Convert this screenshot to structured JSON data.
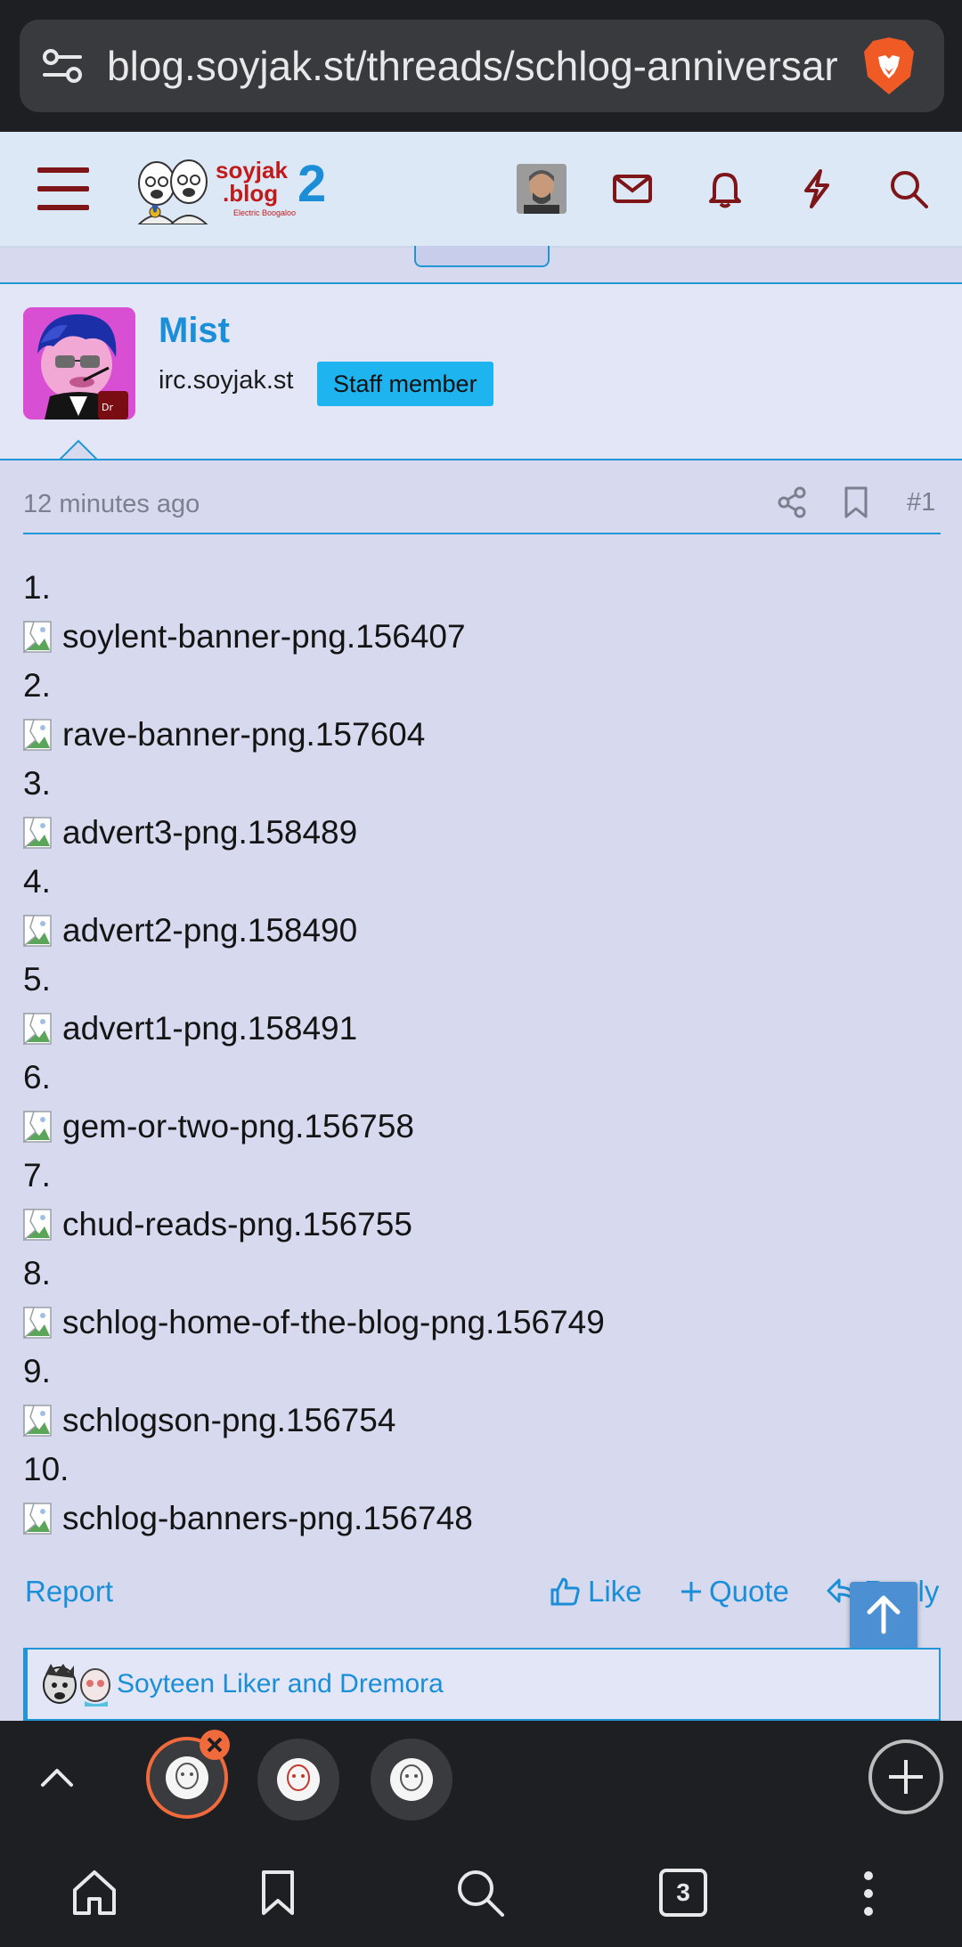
{
  "browser": {
    "url": "blog.soyjak.st/threads/schlog-anniversar",
    "tab_count": "3"
  },
  "site": {
    "logo_line1": "soyjak",
    "logo_line2": ".blog",
    "logo_sub": "Electric Boogaloo",
    "logo_number": "2"
  },
  "post": {
    "author": "Mist",
    "user_title": "irc.soyjak.st",
    "badge": "Staff member",
    "time": "12 minutes ago",
    "number": "#1",
    "items": [
      {
        "n": "1.",
        "file": "soylent-banner-png.156407"
      },
      {
        "n": "2.",
        "file": "rave-banner-png.157604"
      },
      {
        "n": "3.",
        "file": "advert3-png.158489"
      },
      {
        "n": "4.",
        "file": "advert2-png.158490"
      },
      {
        "n": "5.",
        "file": "advert1-png.158491"
      },
      {
        "n": "6.",
        "file": "gem-or-two-png.156758"
      },
      {
        "n": "7.",
        "file": "chud-reads-png.156755"
      },
      {
        "n": "8.",
        "file": "schlog-home-of-the-blog-png.156749"
      },
      {
        "n": "9.",
        "file": "schlogson-png.156754"
      },
      {
        "n": "10.",
        "file": "schlog-banners-png.156748"
      }
    ],
    "actions": {
      "report": "Report",
      "like": "Like",
      "quote": "Quote",
      "reply": "Reply"
    },
    "reactions_text": "Soyteen Liker and Dremora"
  },
  "colors": {
    "accent": "#1a8fd8",
    "brand_red": "#7d1519",
    "badge": "#1db4f0"
  }
}
